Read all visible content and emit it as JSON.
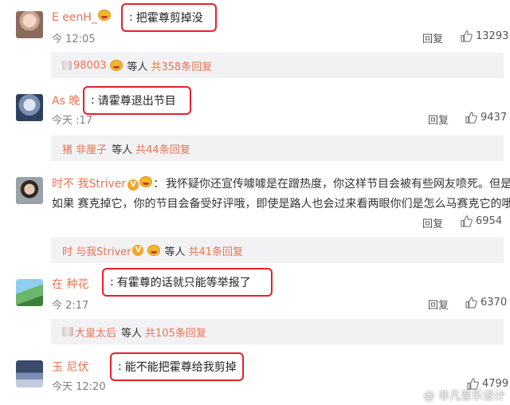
{
  "colors": {
    "accent": "#eb7350",
    "highlight": "#e8202a",
    "sub_bg": "#f2f2f5"
  },
  "comments": [
    {
      "name": "E  eenH_",
      "text": "把霍尊剪掉没",
      "time": "今  12:05",
      "reply": "回复",
      "likes": "13293",
      "sub_name": "98003",
      "sub_mid": "等人",
      "sub_more": "共358条回复"
    },
    {
      "name": "As  晚",
      "text": "请霍尊退出节目",
      "time": "今天  :17",
      "reply": "回复",
      "likes": "9437",
      "sub_name": "猪  非厘子",
      "sub_mid": "等人",
      "sub_more": "共44条回复"
    },
    {
      "name": "时不  我Striver",
      "text_line1": "我怀疑你还宣传噱噱是在蹭热度，你这样节目会被有些网友喷死。但是你",
      "text_line2": "如果  赛克掉它，你的节目会备受好评哦，即使是路人也会过来看两眼你们是怎么马赛克它的哦。",
      "time": "",
      "reply": "回复",
      "likes": "6954",
      "sub_name": "时  与我Striver",
      "sub_mid": "等人",
      "sub_more": "共41条回复"
    },
    {
      "name": "在  种花",
      "text": "有霍尊的话就只能等举报了",
      "time": "今  2:17",
      "reply": "回复",
      "likes": "6370",
      "sub_name": "  大皇太后",
      "sub_mid": "等人",
      "sub_more": "共105条回复"
    },
    {
      "name": "玉  尼伏",
      "text": "能不能把霍尊给我剪掉",
      "time": "今天 12:20",
      "reply": "回复",
      "likes": "4799"
    }
  ],
  "icons": {
    "like": "thumbs-up-icon",
    "badge": "verified-v-icon",
    "emoji": "emoji-face-icon"
  },
  "watermark": "@ 非凡音乐设计"
}
